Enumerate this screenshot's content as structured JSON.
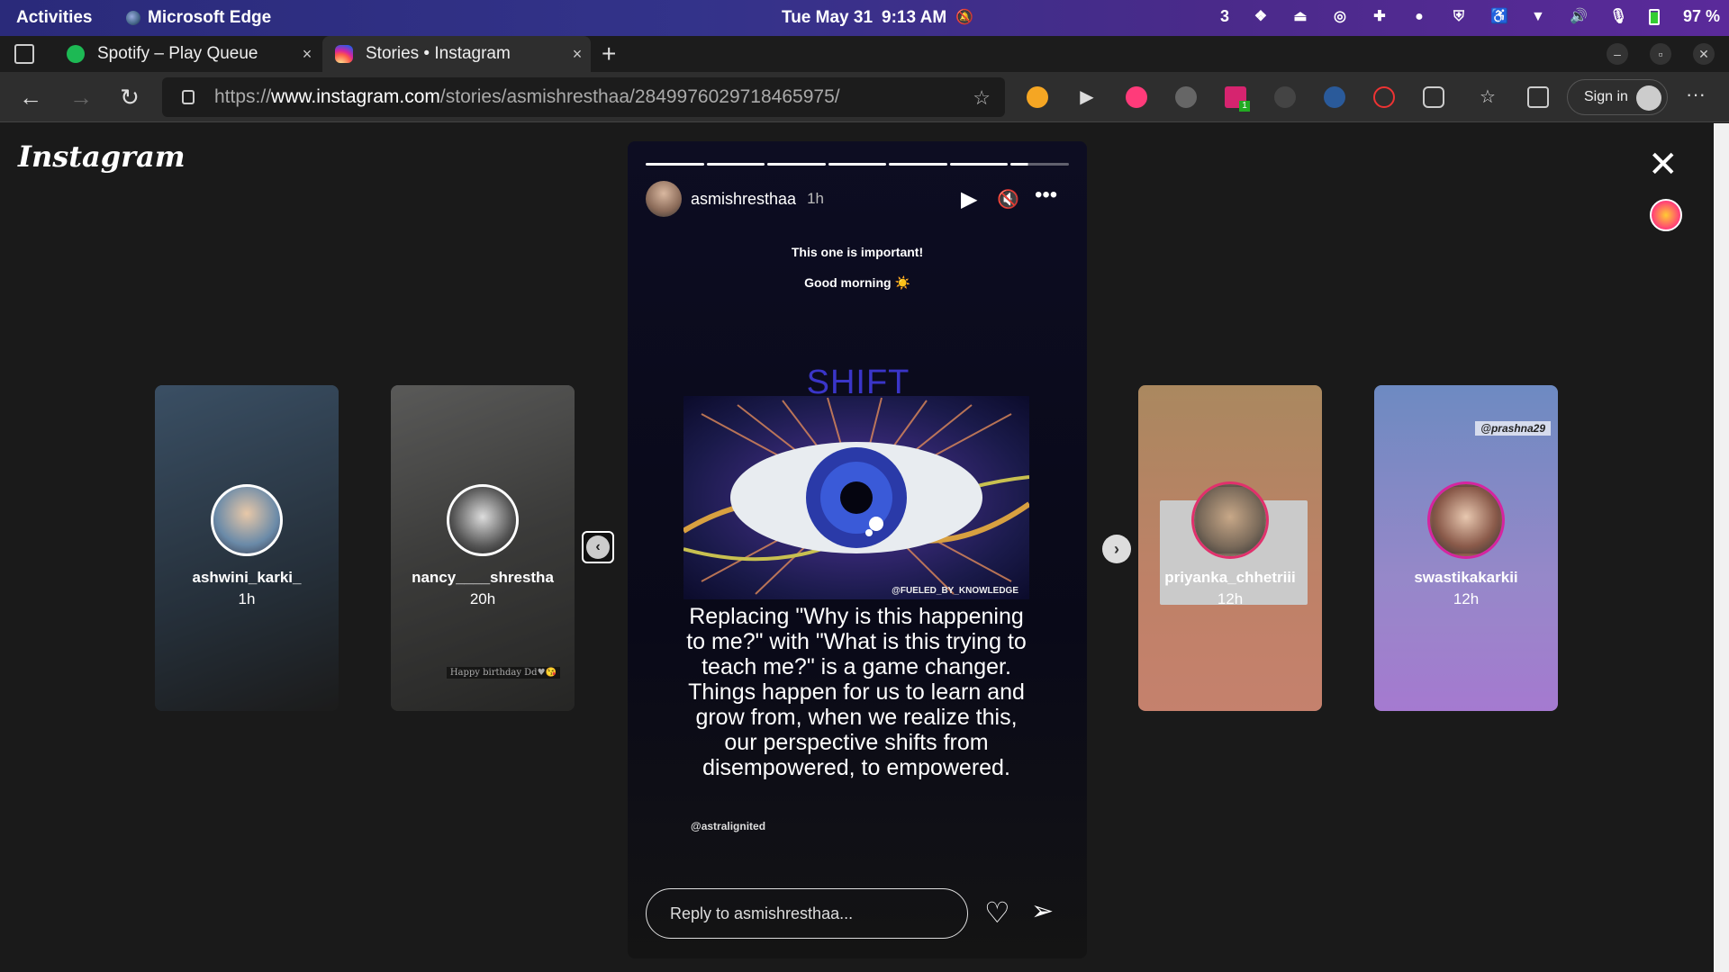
{
  "system_bar": {
    "activities": "Activities",
    "app_name": "Microsoft Edge",
    "date": "Tue May 31",
    "time": "9:13 AM",
    "notification_count": "3",
    "battery": "97 %"
  },
  "tabs": [
    {
      "label": "Spotify – Play Queue",
      "close": "×"
    },
    {
      "label": "Stories • Instagram",
      "close": "×"
    }
  ],
  "new_tab": "+",
  "address_bar": {
    "url_prefix": "https://",
    "url_host": "www.instagram.com",
    "url_path": "/stories/asmishresthaa/2849976029718465975/"
  },
  "toolbar": {
    "sign_in": "Sign in",
    "more": "···",
    "extension_badge": "1"
  },
  "instagram": {
    "logo": "Instagram",
    "close": "✕",
    "side_stories_left": [
      {
        "username": "ashwini_karki_",
        "time": "1h"
      },
      {
        "username": "nancy____shrestha",
        "time": "20h",
        "caption": "Happy birthday Dd♥😘"
      }
    ],
    "side_stories_right": [
      {
        "username": "priyanka_chhetriii",
        "time": "12h"
      },
      {
        "username": "swastikakarkii",
        "time": "12h",
        "caption": "@prashna29"
      }
    ],
    "active_story": {
      "username": "asmishresthaa",
      "time": "1h",
      "line1": "This one is important!",
      "line2": "Good morning ☀️",
      "title": "SHIFT PERSPECTIVES",
      "image_credit": "@FUELED_BY_KNOWLEDGE",
      "quote": "Replacing \"Why is this happening to me?\" with \"What is this trying to teach me?\" is a game changer. Things happen for us to learn and grow from, when we realize this, our perspective shifts from disempowered, to empowered.",
      "handle": "@astralignited",
      "reply_placeholder": "Reply to asmishresthaa...",
      "progress_total": 7,
      "progress_done": 6
    }
  },
  "colors": {
    "topbar_start": "#2a2a7a",
    "topbar_end": "#5a2a9a",
    "title_blue": "#3a35c8",
    "story_ring": "#e1306c",
    "spotify": "#1db954"
  }
}
